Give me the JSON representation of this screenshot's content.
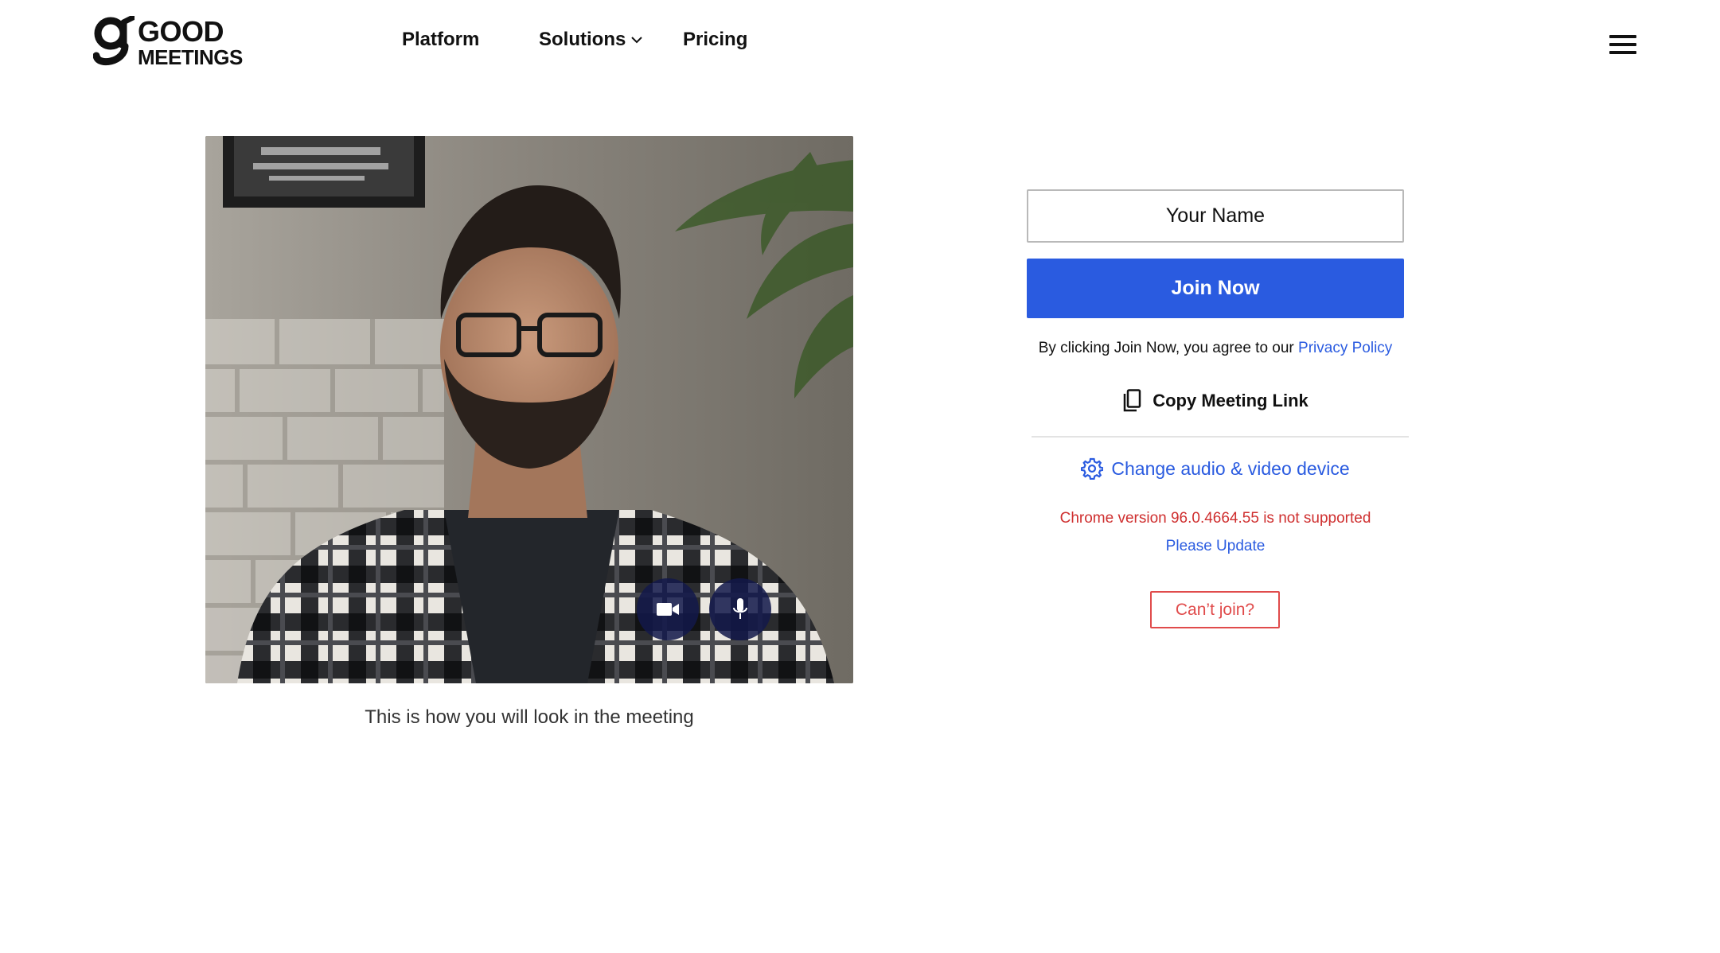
{
  "brand": {
    "logo_line1": "GOOD",
    "logo_line2": "MEETINGS",
    "icon": "g-logo-icon"
  },
  "nav": {
    "items": [
      {
        "label": "Platform"
      },
      {
        "label": "Solutions",
        "icon": "chevron-down-icon"
      },
      {
        "label": "Pricing"
      }
    ],
    "menu_icon": "hamburger-menu-icon"
  },
  "preview": {
    "caption": "This is how you will look in the meeting",
    "controls": [
      {
        "name": "camera",
        "icon": "video-camera-icon"
      },
      {
        "name": "microphone",
        "icon": "microphone-icon"
      }
    ]
  },
  "join": {
    "name_placeholder": "Your Name",
    "name_value": "",
    "join_label": "Join Now",
    "agree_text": "By clicking Join Now, you agree to our ",
    "privacy_label": "Privacy Policy",
    "copy_label": "Copy Meeting Link",
    "copy_icon": "copy-icon",
    "device_label": "Change audio & video device",
    "device_icon": "gear-icon",
    "warning": "Chrome version 96.0.4664.55 is not supported",
    "update_label": "Please Update",
    "cant_join_label": "Can’t join?"
  },
  "colors": {
    "accent": "#2a5be0",
    "error": "#cf2f2f",
    "cant_join": "#e04b4b",
    "control_bg": "#13184a"
  }
}
